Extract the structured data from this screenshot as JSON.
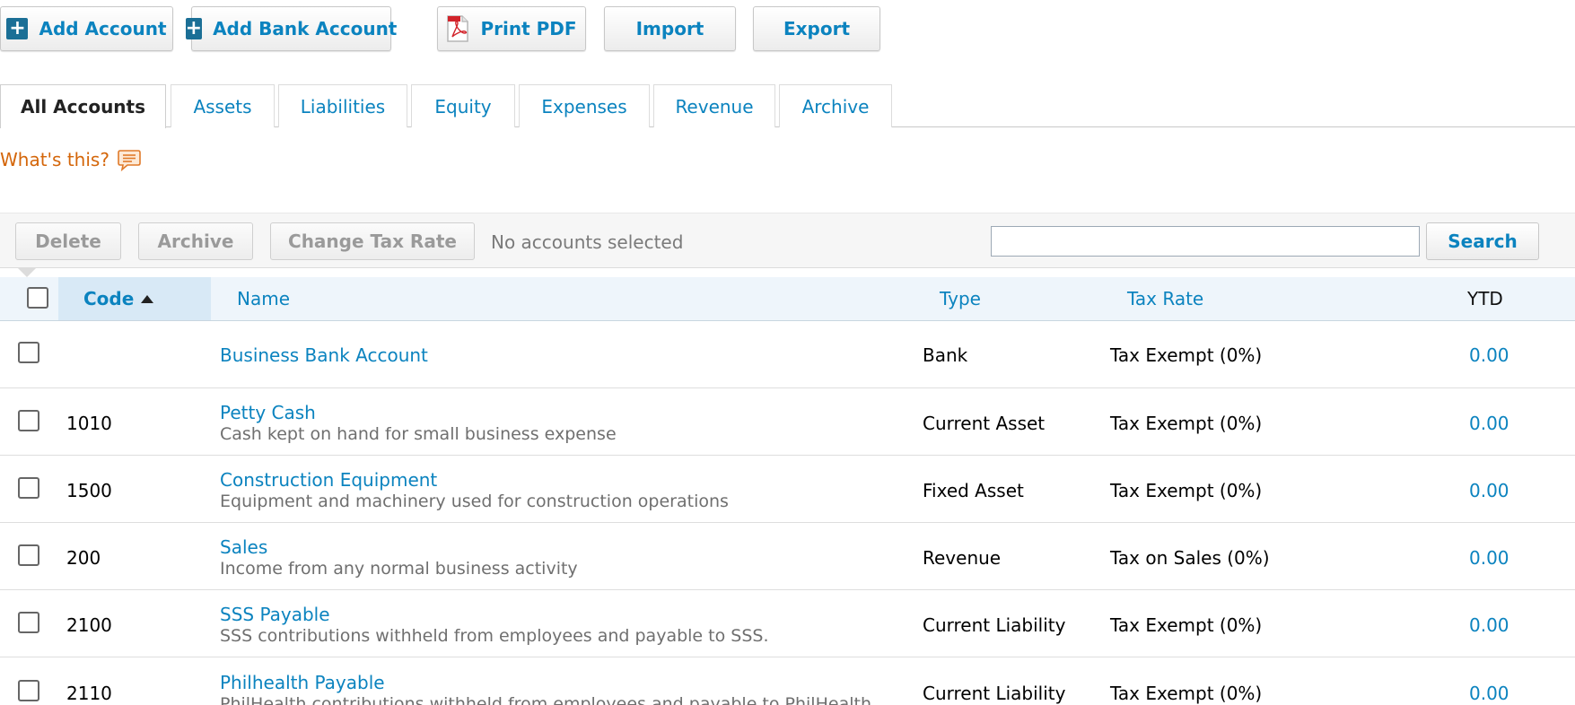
{
  "toolbar": {
    "add_account": "Add Account",
    "add_bank_account": "Add Bank Account",
    "print_pdf": "Print PDF",
    "import": "Import",
    "export": "Export"
  },
  "tabs": [
    "All Accounts",
    "Assets",
    "Liabilities",
    "Equity",
    "Expenses",
    "Revenue",
    "Archive"
  ],
  "active_tab": "All Accounts",
  "help": {
    "whats_this": "What's this?"
  },
  "actions": {
    "delete": "Delete",
    "archive": "Archive",
    "change_tax_rate": "Change Tax Rate",
    "selection_status": "No accounts selected",
    "search_value": "",
    "search_button": "Search"
  },
  "table": {
    "headers": {
      "code": "Code",
      "name": "Name",
      "type": "Type",
      "tax_rate": "Tax Rate",
      "ytd": "YTD"
    },
    "sort": {
      "column": "code",
      "direction": "ascending"
    },
    "rows": [
      {
        "code": "",
        "name": "Business Bank Account",
        "description": "",
        "type": "Bank",
        "tax_rate": "Tax Exempt (0%)",
        "ytd": "0.00"
      },
      {
        "code": "1010",
        "name": "Petty Cash",
        "description": "Cash kept on hand for small business expense",
        "type": "Current Asset",
        "tax_rate": "Tax Exempt (0%)",
        "ytd": "0.00"
      },
      {
        "code": "1500",
        "name": "Construction Equipment",
        "description": "Equipment and machinery used for construction operations",
        "type": "Fixed Asset",
        "tax_rate": "Tax Exempt (0%)",
        "ytd": "0.00"
      },
      {
        "code": "200",
        "name": "Sales",
        "description": "Income from any normal business activity",
        "type": "Revenue",
        "tax_rate": "Tax on Sales (0%)",
        "ytd": "0.00"
      },
      {
        "code": "2100",
        "name": "SSS Payable",
        "description": "SSS contributions withheld from employees and payable to SSS.",
        "type": "Current Liability",
        "tax_rate": "Tax Exempt (0%)",
        "ytd": "0.00"
      },
      {
        "code": "2110",
        "name": "Philhealth Payable",
        "description": "PhilHealth contributions withheld from employees and payable to PhilHealth.",
        "type": "Current Liability",
        "tax_rate": "Tax Exempt (0%)",
        "ytd": "0.00"
      }
    ]
  },
  "colors": {
    "link": "#0b83bf",
    "help": "#d4660a",
    "header_bg": "#eef5fb",
    "sorted_col_bg": "#d8e9f6"
  },
  "icons": {
    "add": "plus-icon",
    "pdf": "pdf-icon",
    "help": "speech-bubble-icon",
    "sort": "sort-ascending-icon"
  }
}
